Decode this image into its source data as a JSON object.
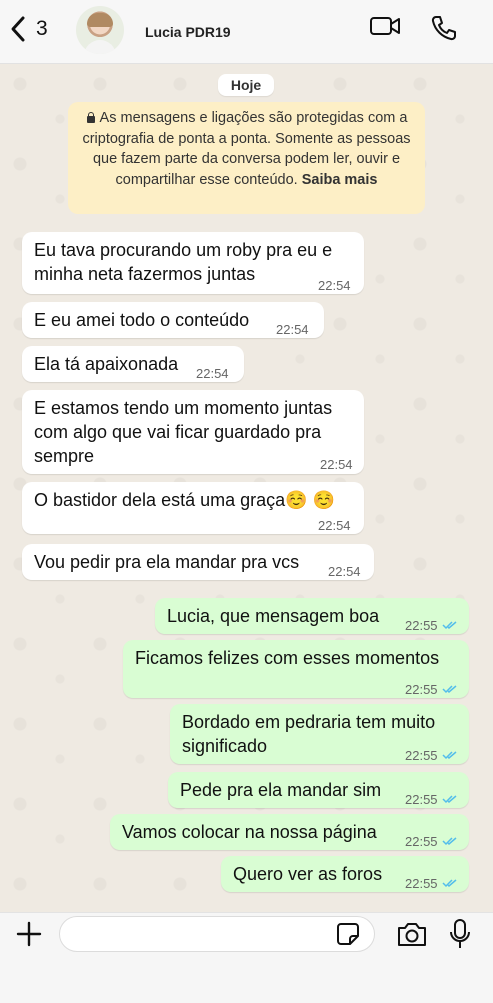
{
  "header": {
    "back_count": "3",
    "contact_name": "Lucia PDR19",
    "avatar_icon": "contact-photo",
    "video_icon": "video-camera-icon",
    "phone_icon": "phone-icon"
  },
  "chat": {
    "date_label": "Hoje",
    "notice": {
      "text": "As mensagens e ligações são protegidas com a criptografia de ponta a ponta. Somente as pessoas que fazem parte da conversa podem ler, ouvir e compartilhar esse conteúdo.",
      "link": "Saiba mais"
    },
    "incoming": [
      {
        "text": "Eu tava procurando um roby pra eu e\nminha neta fazermos juntas",
        "time": "22:54"
      },
      {
        "text": "E eu amei todo o conteúdo",
        "time": "22:54"
      },
      {
        "text": "Ela tá apaixonada",
        "time": "22:54"
      },
      {
        "text": "E estamos tendo um momento juntas\ncom algo que vai ficar guardado pra\nsempre",
        "time": "22:54"
      },
      {
        "text": "O bastidor dela está uma graça☺️ ☺️",
        "time": "22:54"
      },
      {
        "text": "Vou pedir pra ela mandar pra vcs",
        "time": "22:54"
      }
    ],
    "outgoing": [
      {
        "text": "Lucia, que mensagem boa",
        "time": "22:55"
      },
      {
        "text": "Ficamos felizes com esses momentos",
        "time": "22:55"
      },
      {
        "text": "Bordado em pedraria tem muito\nsignificado",
        "time": "22:55"
      },
      {
        "text": "Pede pra ela mandar sim",
        "time": "22:55"
      },
      {
        "text": "Vamos colocar na nossa página",
        "time": "22:55"
      },
      {
        "text": "Quero ver as foros",
        "time": "22:55"
      }
    ]
  },
  "composer": {
    "input_value": "",
    "plus_icon": "plus-icon",
    "sticker_icon": "sticker-icon",
    "camera_icon": "camera-icon",
    "mic_icon": "microphone-icon"
  },
  "colors": {
    "chat_bg": "#efeae2",
    "incoming_bubble": "#ffffff",
    "outgoing_bubble": "#d9fdd3",
    "notice_bg": "#fdefc6",
    "read_ticks": "#53bdeb"
  }
}
